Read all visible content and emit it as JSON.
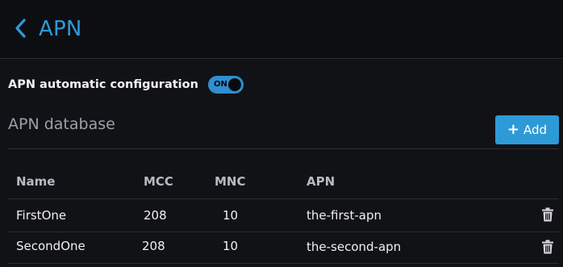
{
  "header": {
    "title": "APN",
    "back_icon": "chevron-left-icon",
    "accent_color": "#2d9ad7"
  },
  "auto_config": {
    "label": "APN automatic configuration",
    "toggle_text": "ON",
    "enabled": true
  },
  "database": {
    "title": "APN database",
    "add_label": "Add",
    "add_icon": "plus-icon"
  },
  "table": {
    "headers": {
      "name": "Name",
      "mcc": "MCC",
      "mnc": "MNC",
      "apn": "APN"
    },
    "rows": [
      {
        "name": "FirstOne",
        "mcc": "208",
        "mnc": "10",
        "apn": "the-first-apn",
        "action_icon": "trash-icon"
      },
      {
        "name": "SecondOne",
        "mcc": "208",
        "mnc": "10",
        "apn": "the-second-apn",
        "action_icon": "trash-icon"
      }
    ]
  }
}
